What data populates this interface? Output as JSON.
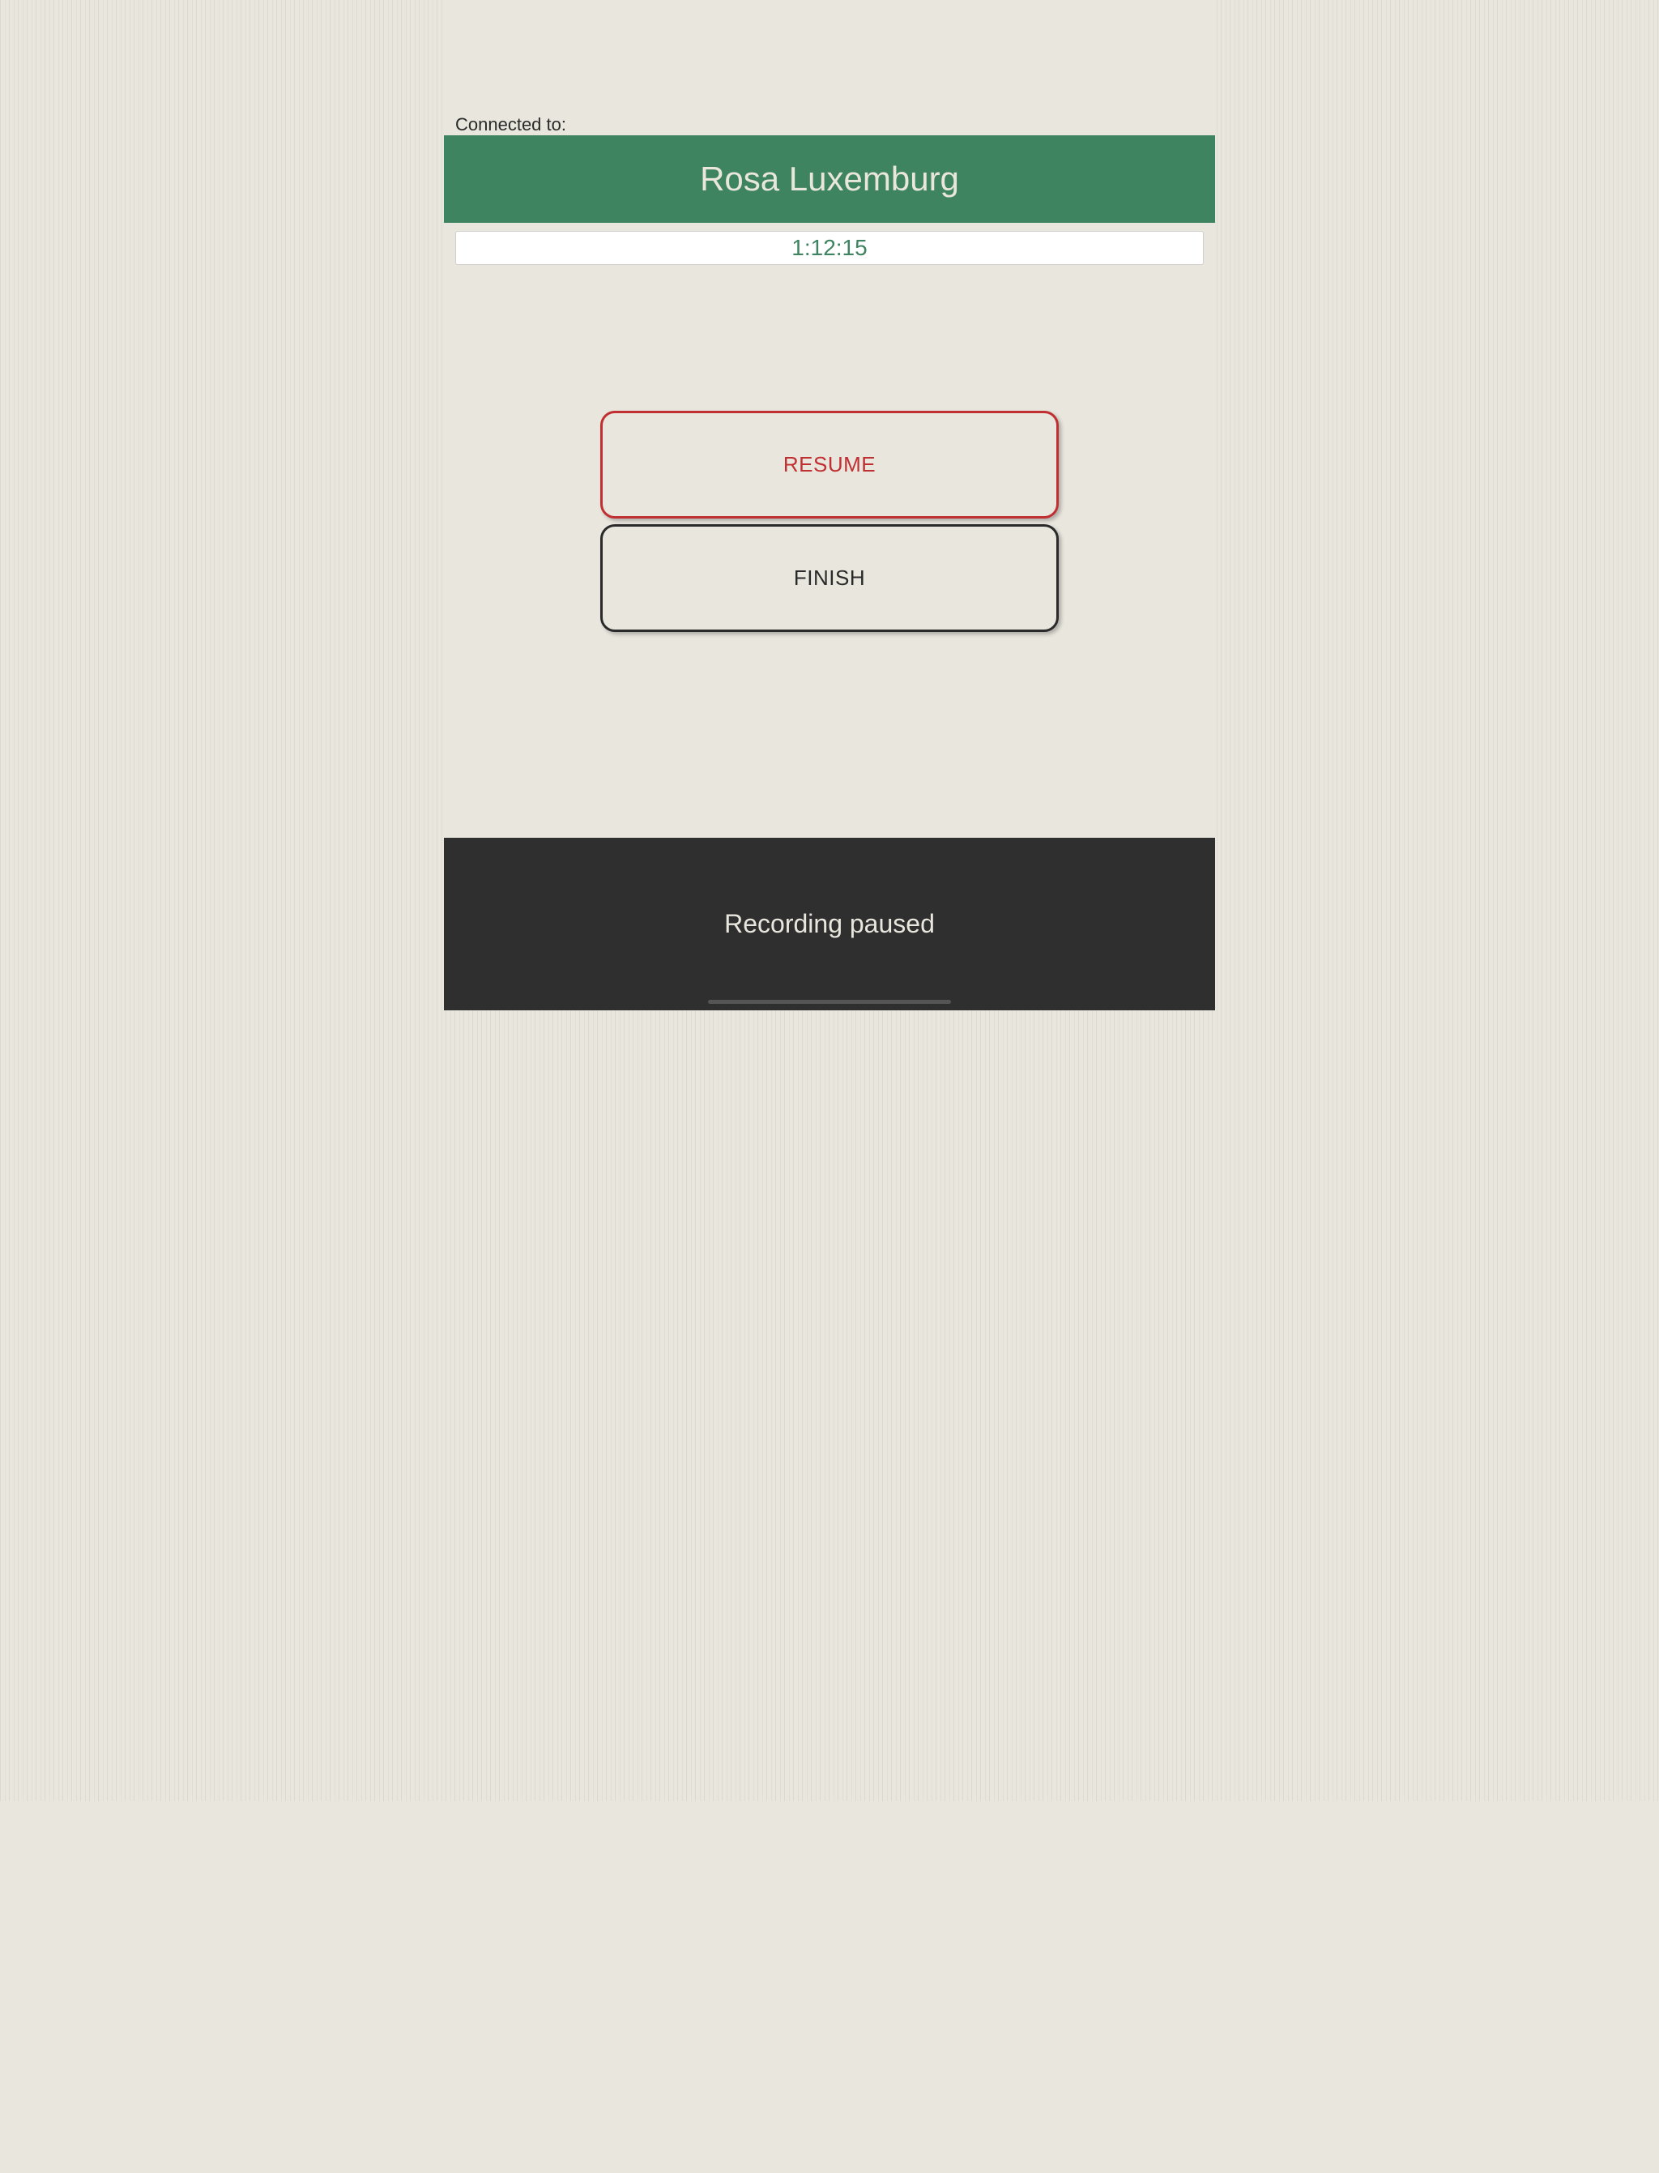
{
  "connection": {
    "label": "Connected to:",
    "name": "Rosa Luxemburg"
  },
  "timer": {
    "value": "1:12:15"
  },
  "buttons": {
    "resume": "RESUME",
    "finish": "FINISH"
  },
  "status": {
    "text": "Recording paused"
  },
  "colors": {
    "accent_green": "#3f8461",
    "accent_red": "#c02f32",
    "background": "#e8e6dd",
    "dark": "#2f2f2f"
  }
}
